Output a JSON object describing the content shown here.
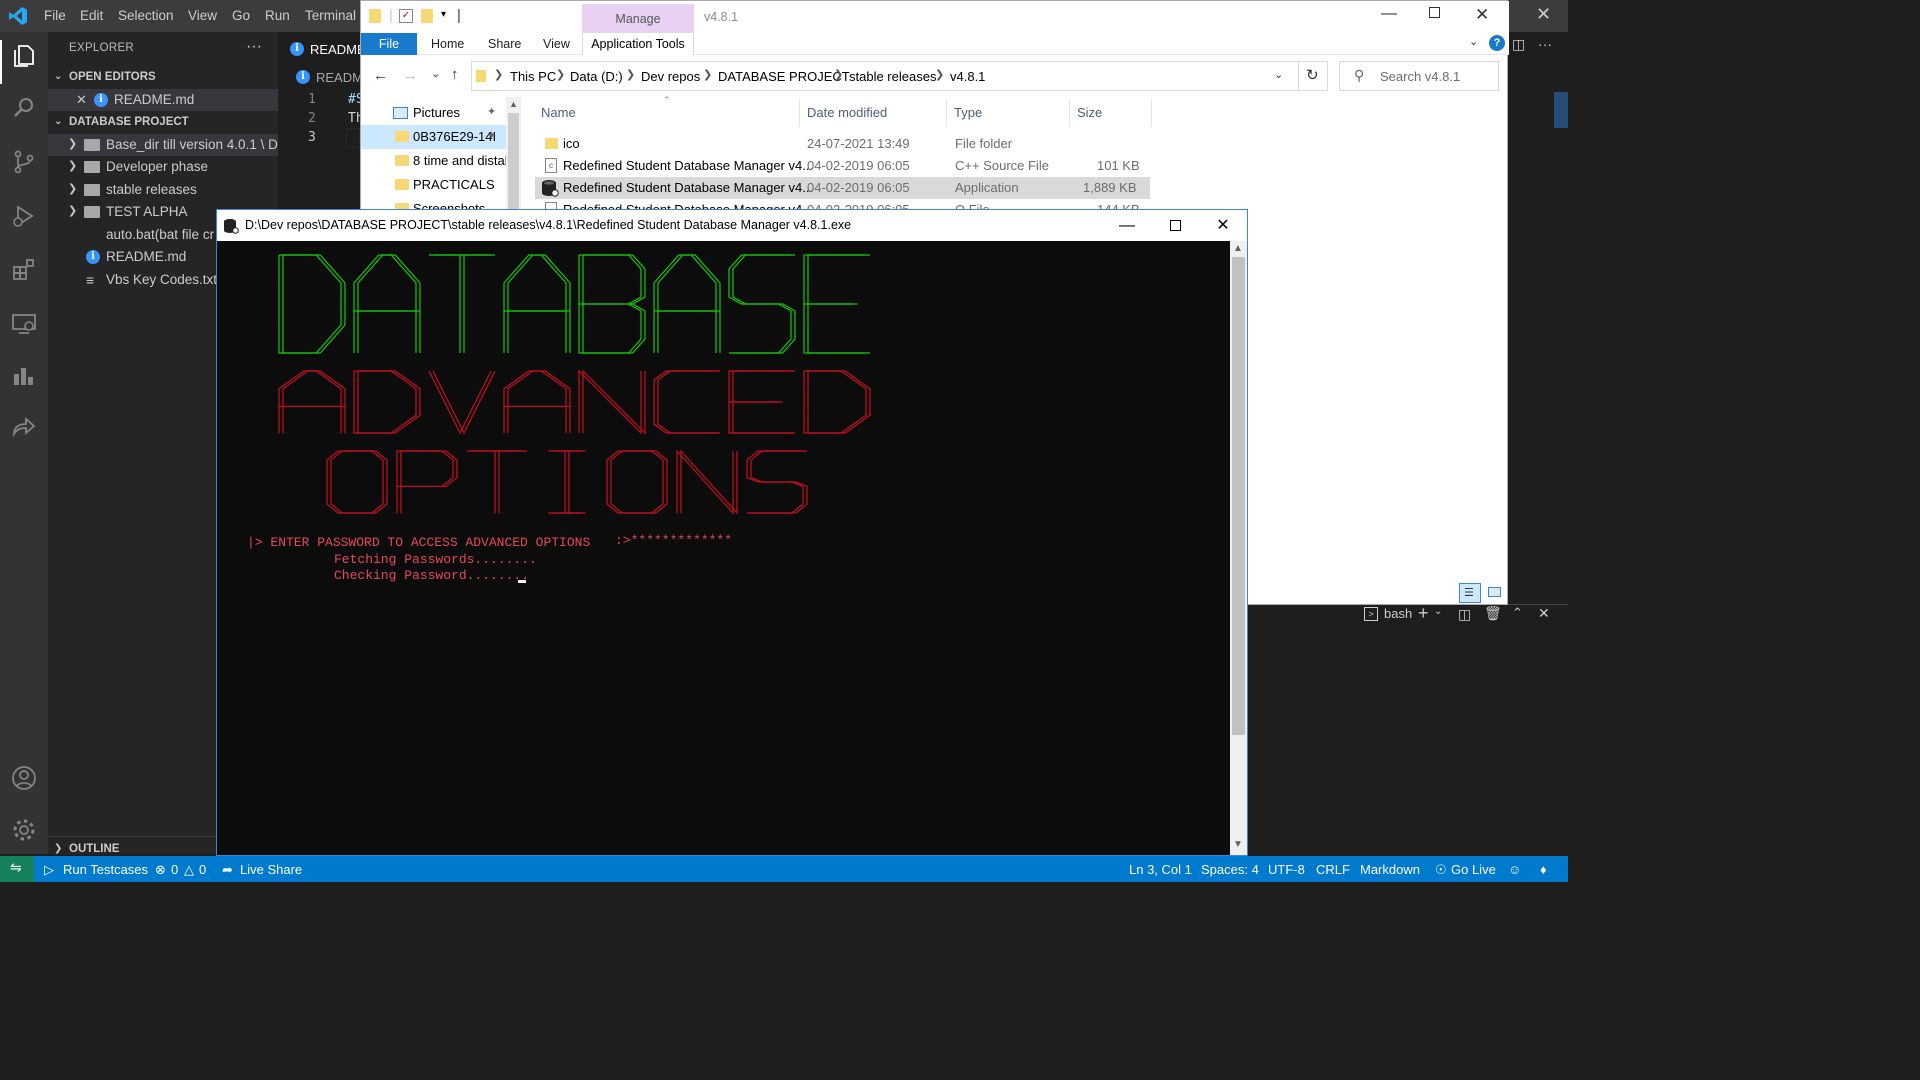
{
  "vscode": {
    "menu": [
      "File",
      "Edit",
      "Selection",
      "View",
      "Go",
      "Run",
      "Terminal"
    ],
    "sidebar": {
      "title": "EXPLORER",
      "open_editors_label": "OPEN EDITORS",
      "open_editors": [
        {
          "name": "README.md",
          "icon": "info-icon"
        }
      ],
      "project_label": "DATABASE PROJECT",
      "tree": [
        {
          "name": "Base_dir till version 4.0.1 \\ D...",
          "type": "folder",
          "collapsed": true
        },
        {
          "name": "Developer phase",
          "type": "folder",
          "collapsed": true
        },
        {
          "name": "stable releases",
          "type": "folder",
          "collapsed": true
        },
        {
          "name": "TEST ALPHA",
          "type": "folder",
          "collapsed": true
        },
        {
          "name": "auto.bat(bat file cr",
          "type": "file"
        },
        {
          "name": "README.md",
          "type": "file",
          "icon": "info-icon"
        },
        {
          "name": "Vbs Key Codes.txt",
          "type": "file"
        }
      ],
      "outline_label": "OUTLINE"
    },
    "editor": {
      "tab": "README",
      "breadcrumb": "READM",
      "lines": [
        {
          "num": "1",
          "text": "#S"
        },
        {
          "num": "2",
          "text": "Th"
        },
        {
          "num": "3",
          "text": ""
        }
      ]
    },
    "terminal": {
      "shell": "bash"
    },
    "status": {
      "run_testcases": "Run Testcases",
      "errors": "0",
      "warnings": "0",
      "live_share": "Live Share",
      "position": "Ln 3, Col 1",
      "spaces": "Spaces: 4",
      "encoding": "UTF-8",
      "eol": "CRLF",
      "language": "Markdown",
      "go_live": "Go Live"
    }
  },
  "explorer": {
    "window_title": "v4.8.1",
    "context_tab": "Manage",
    "ribbon_tabs": {
      "file": "File",
      "home": "Home",
      "share": "Share",
      "view": "View",
      "app_tools": "Application Tools"
    },
    "breadcrumb": [
      "This PC",
      "Data (D:)",
      "Dev repos",
      "DATABASE PROJECT",
      "stable releases",
      "v4.8.1"
    ],
    "search_placeholder": "Search v4.8.1",
    "nav": [
      {
        "label": "Pictures",
        "pinned": true
      },
      {
        "label": "0B376E29-14I",
        "pinned": true,
        "selected": true
      },
      {
        "label": "8 time and distal"
      },
      {
        "label": "PRACTICALS"
      },
      {
        "label": "Screenshots"
      }
    ],
    "columns": {
      "name": "Name",
      "modified": "Date modified",
      "type": "Type",
      "size": "Size"
    },
    "files": [
      {
        "name": "ico",
        "modified": "24-07-2021 13:49",
        "type": "File folder",
        "size": "",
        "icon": "folder-icon"
      },
      {
        "name": "Redefined Student Database Manager v4...",
        "modified": "04-02-2019 06:05",
        "type": "C++ Source File",
        "size": "101 KB",
        "icon": "cpp-file-icon"
      },
      {
        "name": "Redefined Student Database Manager v4...",
        "modified": "04-02-2019 06:05",
        "type": "Application",
        "size": "1,889 KB",
        "icon": "database-app-icon",
        "selected": true
      },
      {
        "name": "Redefined Student Database Manager v4...",
        "modified": "04-02-2019 06:05",
        "type": "O File",
        "size": "144 KB",
        "icon": "file-icon"
      }
    ]
  },
  "console": {
    "title": "D:\\Dev repos\\DATABASE PROJECT\\stable releases\\v4.8.1\\Redefined Student Database Manager v4.8.1.exe",
    "banner_words": [
      "DATABASE",
      "ADVANCED",
      "OPTIONS"
    ],
    "prompt": "|> ENTER PASSWORD TO ACCESS ADVANCED OPTIONS",
    "password_mask": ":>*************",
    "line1": "Fetching Passwords........",
    "line2": "Checking Password........",
    "colors": {
      "banner_top": "#16c60c",
      "banner_red": "#c50f1f",
      "text": "#e74856"
    }
  }
}
